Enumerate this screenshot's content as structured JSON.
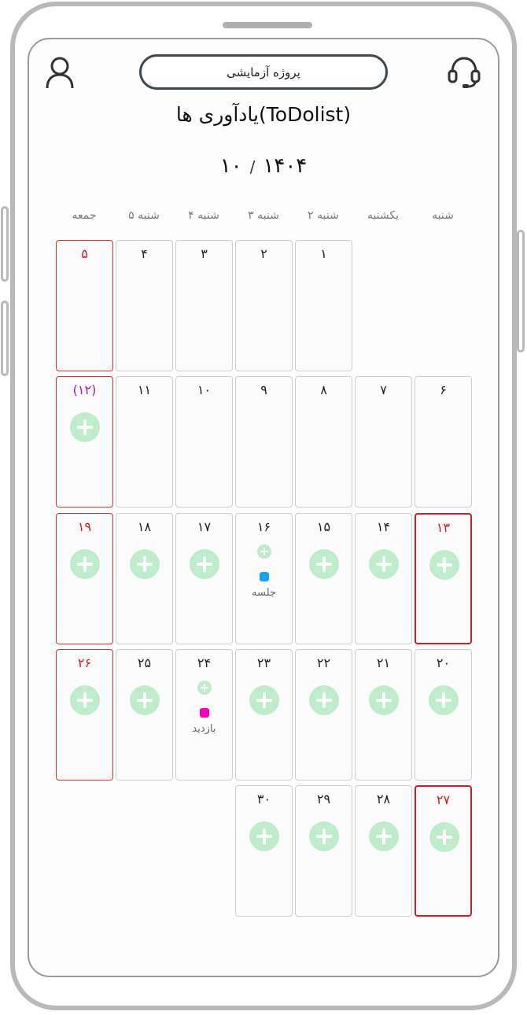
{
  "header": {
    "project_name": "پروژه آزمایشی",
    "title": "یادآوری ها(ToDolist)",
    "month": "۱۰",
    "separator": "/",
    "year": "۱۴۰۴",
    "icons": {
      "left": "user-icon",
      "right": "headset-support-icon"
    }
  },
  "weekdays": [
    "شنبه",
    "یکشنبه",
    "۲ شنبه",
    "۳ شنبه",
    "۴ شنبه",
    "۵ شنبه",
    "جمعه"
  ],
  "colors": {
    "holiday": "#d11a1a",
    "special": "#9b1fa8",
    "add": "#bfeccb",
    "event_blue": "#1aa3e8",
    "event_magenta": "#f000b8"
  },
  "days": {
    "d1": "۱",
    "d2": "۲",
    "d3": "۳",
    "d4": "۴",
    "d5": "۵",
    "d6": "۶",
    "d7": "۷",
    "d8": "۸",
    "d9": "۹",
    "d10": "۱۰",
    "d11": "۱۱",
    "d12": "(۱۲)",
    "d13": "۱۳",
    "d14": "۱۴",
    "d15": "۱۵",
    "d16": "۱۶",
    "d17": "۱۷",
    "d18": "۱۸",
    "d19": "۱۹",
    "d20": "۲۰",
    "d21": "۲۱",
    "d22": "۲۲",
    "d23": "۲۳",
    "d24": "۲۴",
    "d25": "۲۵",
    "d26": "۲۶",
    "d27": "۲۷",
    "d28": "۲۸",
    "d29": "۲۹",
    "d30": "۳۰"
  },
  "events": {
    "d16": {
      "label": "جلسه",
      "color": "#1aa3e8"
    },
    "d24": {
      "label": "بازدید",
      "color": "#f000b8"
    }
  }
}
